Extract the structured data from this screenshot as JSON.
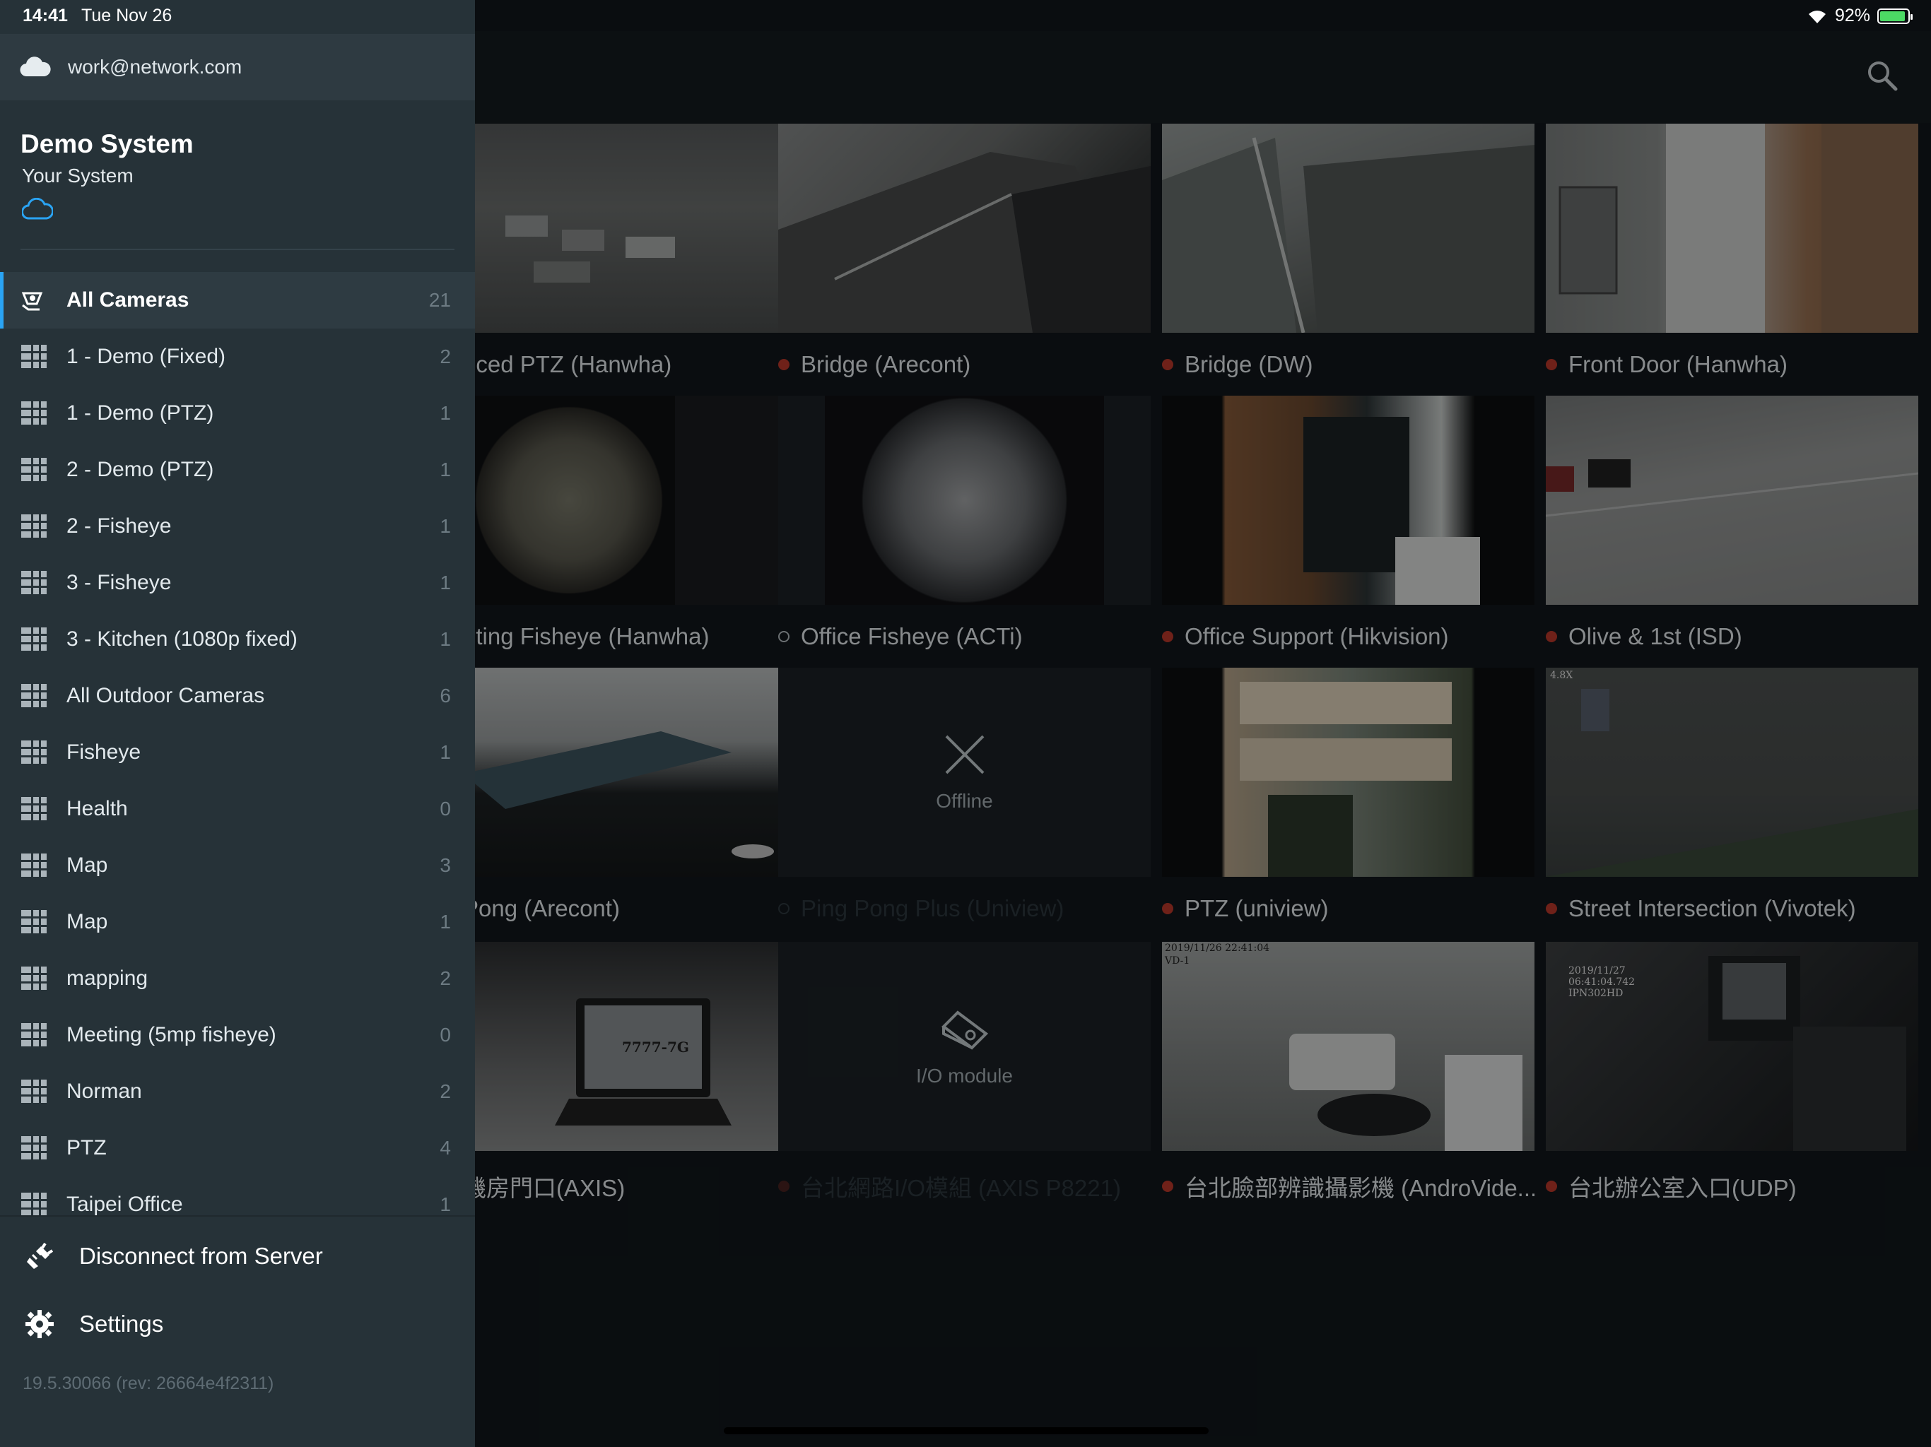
{
  "status_bar": {
    "time": "14:41",
    "date": "Tue Nov 26",
    "battery": "92%",
    "battery_level": 0.92
  },
  "drawer": {
    "account_email": "work@network.com",
    "system_name": "Demo System",
    "system_subtitle": "Your System",
    "items": [
      {
        "label": "All Cameras",
        "count": "21",
        "icon": "camera-icon",
        "active": true
      },
      {
        "label": "1 - Demo (Fixed)",
        "count": "2",
        "icon": "layout-icon"
      },
      {
        "label": "1 - Demo (PTZ)",
        "count": "1",
        "icon": "layout-icon"
      },
      {
        "label": "2 - Demo (PTZ)",
        "count": "1",
        "icon": "layout-icon"
      },
      {
        "label": "2 - Fisheye",
        "count": "1",
        "icon": "layout-icon"
      },
      {
        "label": "3 - Fisheye",
        "count": "1",
        "icon": "layout-icon"
      },
      {
        "label": "3 - Kitchen (1080p fixed)",
        "count": "1",
        "icon": "layout-icon"
      },
      {
        "label": "All Outdoor Cameras",
        "count": "6",
        "icon": "layout-icon"
      },
      {
        "label": "Fisheye",
        "count": "1",
        "icon": "layout-icon"
      },
      {
        "label": "Health",
        "count": "0",
        "icon": "layout-icon"
      },
      {
        "label": "Map",
        "count": "3",
        "icon": "layout-icon"
      },
      {
        "label": "Map",
        "count": "1",
        "icon": "layout-icon"
      },
      {
        "label": "mapping",
        "count": "2",
        "icon": "layout-icon"
      },
      {
        "label": "Meeting (5mp fisheye)",
        "count": "0",
        "icon": "layout-icon"
      },
      {
        "label": "Norman",
        "count": "2",
        "icon": "layout-icon"
      },
      {
        "label": "PTZ",
        "count": "4",
        "icon": "layout-icon"
      },
      {
        "label": "Taipei Office",
        "count": "1",
        "icon": "layout-icon"
      }
    ],
    "disconnect_label": "Disconnect from Server",
    "settings_label": "Settings",
    "version": "19.5.30066 (rev: 26664e4f2311)"
  },
  "cameras": [
    {
      "name": "nced PTZ (Hanwha)",
      "status": "none"
    },
    {
      "name": "Bridge (Arecont)",
      "status": "recording"
    },
    {
      "name": "Bridge (DW)",
      "status": "recording"
    },
    {
      "name": "Front Door (Hanwha)",
      "status": "recording"
    },
    {
      "name": "eting Fisheye (Hanwha)",
      "status": "none"
    },
    {
      "name": "Office Fisheye (ACTi)",
      "status": "online"
    },
    {
      "name": "Office Support (Hikvision)",
      "status": "recording"
    },
    {
      "name": "Olive & 1st (ISD)",
      "status": "recording"
    },
    {
      "name": "Pong (Arecont)",
      "status": "none"
    },
    {
      "name": "Ping Pong Plus (Uniview)",
      "status": "offline",
      "placeholder": "Offline"
    },
    {
      "name": "PTZ (uniview)",
      "status": "recording"
    },
    {
      "name": "Street Intersection (Vivotek)",
      "status": "recording"
    },
    {
      "name": "機房門口(AXIS)",
      "status": "none"
    },
    {
      "name": "台北網路I/O模組 (AXIS P8221)",
      "status": "recording-dim",
      "placeholder": "I/O module"
    },
    {
      "name": "台北臉部辨識攝影機 (AndroVide...",
      "status": "recording"
    },
    {
      "name": "台北辦公室入口(UDP)",
      "status": "recording"
    }
  ],
  "overlays": {
    "street_zoom": "4.8X",
    "room_ts": "2019/11/26 22:41:04",
    "room_cam": "VD-1",
    "taipei_ts1": "2019/11/27",
    "taipei_ts2": "06:41:04.742",
    "taipei_cam": "IPN302HD",
    "plate": "7777-7G"
  }
}
